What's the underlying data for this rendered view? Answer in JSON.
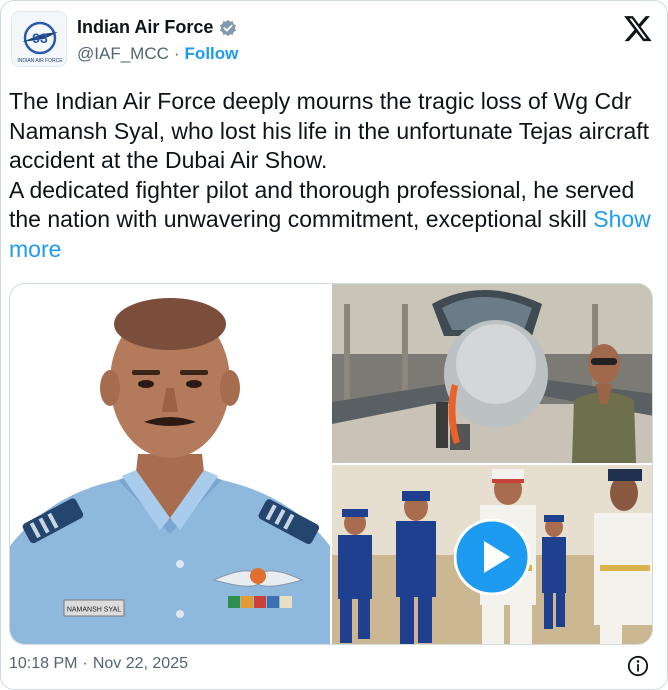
{
  "account": {
    "name": "Indian Air Force",
    "handle": "@IAF_MCC",
    "separator": "·",
    "follow_label": "Follow",
    "avatar_badge_text": "93",
    "avatar_caption": "INDIAN AIR FORCE"
  },
  "tweet": {
    "paragraph1": "The Indian Air Force deeply mourns the tragic loss of Wg Cdr Namansh Syal, who lost his life in the unfortunate Tejas aircraft accident at the Dubai Air Show.",
    "paragraph2": "A dedicated fighter pilot and thorough professional, he served the nation with unwavering commitment, exceptional skill",
    "show_more_label": "Show more"
  },
  "media": {
    "name_tag": "NAMANSH SYAL"
  },
  "footer": {
    "time": "10:18 PM",
    "separator": "·",
    "date": "Nov 22, 2025"
  },
  "colors": {
    "link": "#1d9bf0",
    "verified": "#829aab",
    "uniform": "#8fb8dd",
    "text_secondary": "#536471"
  },
  "icons": [
    "verified-badge-icon",
    "x-logo-icon",
    "play-icon",
    "info-icon"
  ]
}
